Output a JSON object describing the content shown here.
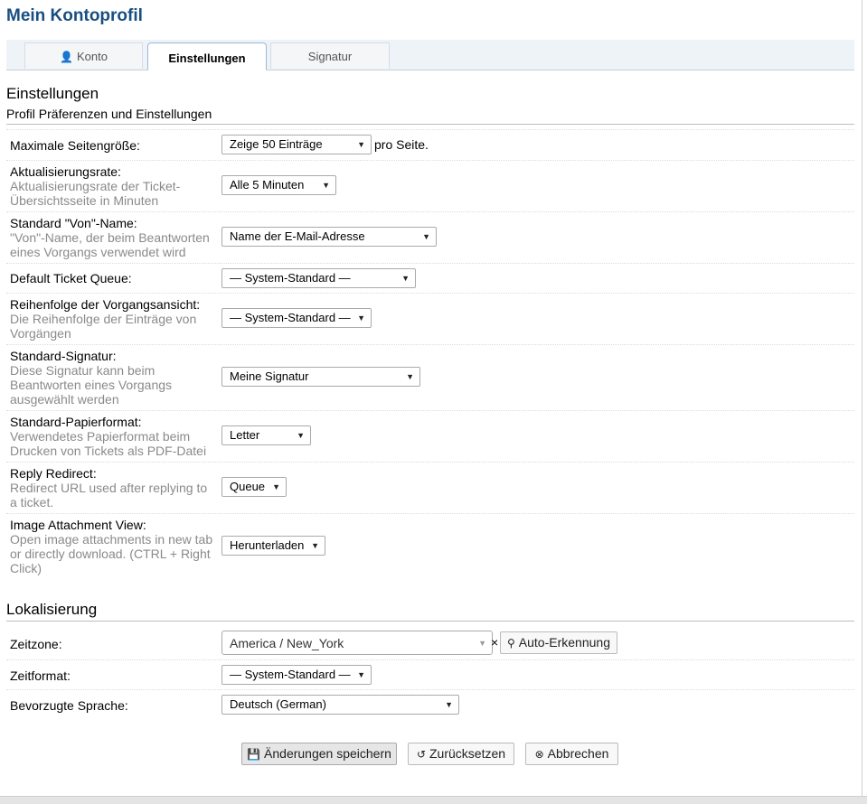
{
  "page_title": "Mein Kontoprofil",
  "tabs": [
    {
      "label": "Konto",
      "icon": "user-icon"
    },
    {
      "label": "Einstellungen"
    },
    {
      "label": "Signatur"
    }
  ],
  "settings": {
    "heading": "Einstellungen",
    "subheading": "Profil Präferenzen und Einstellungen",
    "rows": [
      {
        "title": "Maximale Seitengröße:",
        "desc": "",
        "value": "Zeige 50 Einträge",
        "after": "pro Seite."
      },
      {
        "title": "Aktualisierungsrate:",
        "desc": "Aktualisierungsrate der Ticket-Übersichtsseite in Minuten",
        "value": "Alle 5 Minuten"
      },
      {
        "title": "Standard \"Von\"-Name:",
        "desc": "\"Von\"-Name, der beim Beantworten eines Vorgangs verwendet wird",
        "value": "Name der E-Mail-Adresse"
      },
      {
        "title": "Default Ticket Queue:",
        "desc": "",
        "value": "— System-Standard —"
      },
      {
        "title": "Reihenfolge der Vorgangsansicht:",
        "desc": "Die Reihenfolge der Einträge von Vorgängen",
        "value": "— System-Standard —"
      },
      {
        "title": "Standard-Signatur:",
        "desc": "Diese Signatur kann beim Beantworten eines Vorgangs ausgewählt werden",
        "value": "Meine Signatur"
      },
      {
        "title": "Standard-Papierformat:",
        "desc": "Verwendetes Papierformat beim Drucken von Tickets als PDF-Datei",
        "value": "Letter"
      },
      {
        "title": "Reply Redirect:",
        "desc": "Redirect URL used after replying to a ticket.",
        "value": "Queue"
      },
      {
        "title": "Image Attachment View:",
        "desc": "Open image attachments in new tab or directly download. (CTRL + Right Click)",
        "value": "Herunterladen"
      }
    ]
  },
  "localization": {
    "heading": "Lokalisierung",
    "timezone": {
      "title": "Zeitzone:",
      "value": "America / New_York",
      "clear": "×",
      "auto_label": "Auto-Erkennung"
    },
    "timeformat": {
      "title": "Zeitformat:",
      "value": "— System-Standard —"
    },
    "language": {
      "title": "Bevorzugte Sprache:",
      "value": "Deutsch (German)"
    }
  },
  "buttons": {
    "save": "Änderungen speichern",
    "reset": "Zurücksetzen",
    "cancel": "Abbrechen"
  }
}
